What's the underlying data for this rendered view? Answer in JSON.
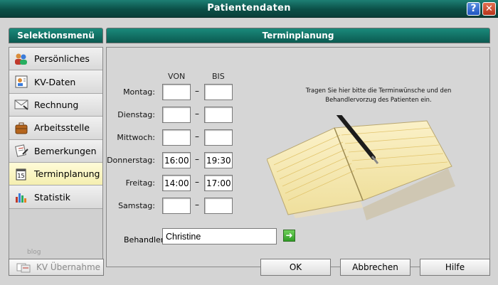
{
  "window": {
    "title": "Patientendaten",
    "help_label": "?",
    "close_label": "✕"
  },
  "sidebar": {
    "header": "Selektionsmenü",
    "items": [
      {
        "label": "Persönliches",
        "icon": "people-icon"
      },
      {
        "label": "KV-Daten",
        "icon": "id-card-icon"
      },
      {
        "label": "Rechnung",
        "icon": "envelope-icon"
      },
      {
        "label": "Arbeitsstelle",
        "icon": "briefcase-icon"
      },
      {
        "label": "Bemerkungen",
        "icon": "notes-icon"
      },
      {
        "label": "Terminplanung",
        "icon": "calendar-icon",
        "active": true
      },
      {
        "label": "Statistik",
        "icon": "bar-chart-icon"
      }
    ]
  },
  "main": {
    "header": "Terminplanung",
    "col_von": "VON",
    "col_bis": "BIS",
    "days": [
      {
        "label": "Montag:",
        "von": "",
        "bis": ""
      },
      {
        "label": "Dienstag:",
        "von": "",
        "bis": ""
      },
      {
        "label": "Mittwoch:",
        "von": "",
        "bis": ""
      },
      {
        "label": "Donnerstag:",
        "von": "16:00",
        "bis": "19:30"
      },
      {
        "label": "Freitag:",
        "von": "14:00",
        "bis": "17:00"
      },
      {
        "label": "Samstag:",
        "von": "",
        "bis": ""
      }
    ],
    "dash": "–",
    "behandler_label": "Behandler:",
    "behandler_value": "Christine",
    "hint_line1": "Tragen Sie hier bitte die Terminwünsche und den",
    "hint_line2": "Behandlervorzug des Patienten ein."
  },
  "footer": {
    "kv_label": "KV Übernahme",
    "ok_label": "OK",
    "cancel_label": "Abbrechen",
    "help_label": "Hilfe",
    "watermark": "blog"
  },
  "colors": {
    "accent": "#0e6a60",
    "active_item": "#f8f2c0"
  }
}
